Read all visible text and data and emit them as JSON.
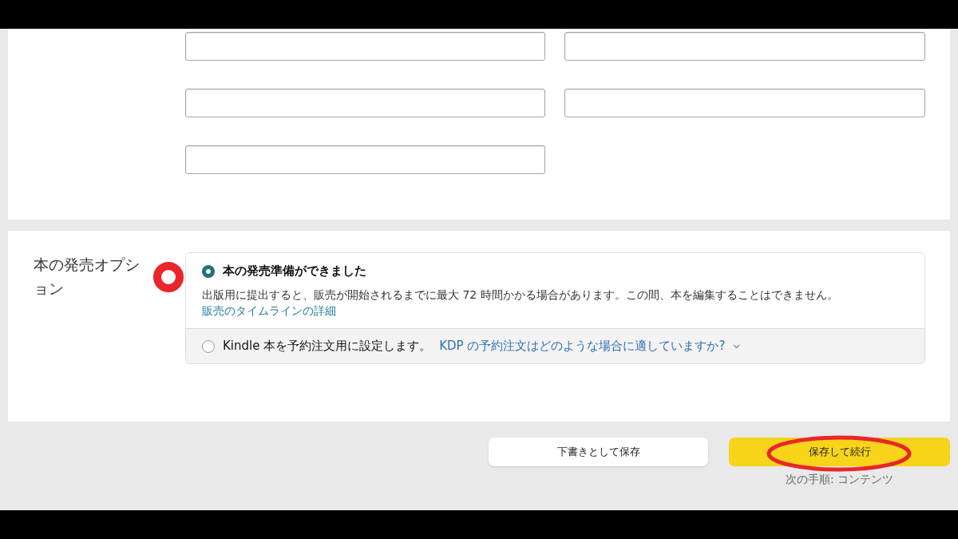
{
  "form_fields": [
    {
      "kind": "text"
    },
    {
      "kind": "text"
    },
    {
      "kind": "text"
    },
    {
      "kind": "text"
    },
    {
      "kind": "text"
    }
  ],
  "release_options": {
    "title": "本の発売オプション",
    "options": [
      {
        "label": "本の発売準備ができました",
        "selected": true,
        "description": "出版用に提出すると、販売が開始されるまでに最大 72 時間かかる場合があります。この間、本を編集することはできません。",
        "link": "販売のタイムラインの詳細",
        "expandable": false
      },
      {
        "label": "Kindle 本を予約注文用に設定します。",
        "selected": false,
        "link": "KDP の予約注文はどのような場合に適していますか?",
        "expandable": true
      }
    ]
  },
  "actions": {
    "draft_button": "下書きとして保存",
    "continue_button": "保存して続行",
    "next_step": "次の手順: コンテンツ"
  }
}
